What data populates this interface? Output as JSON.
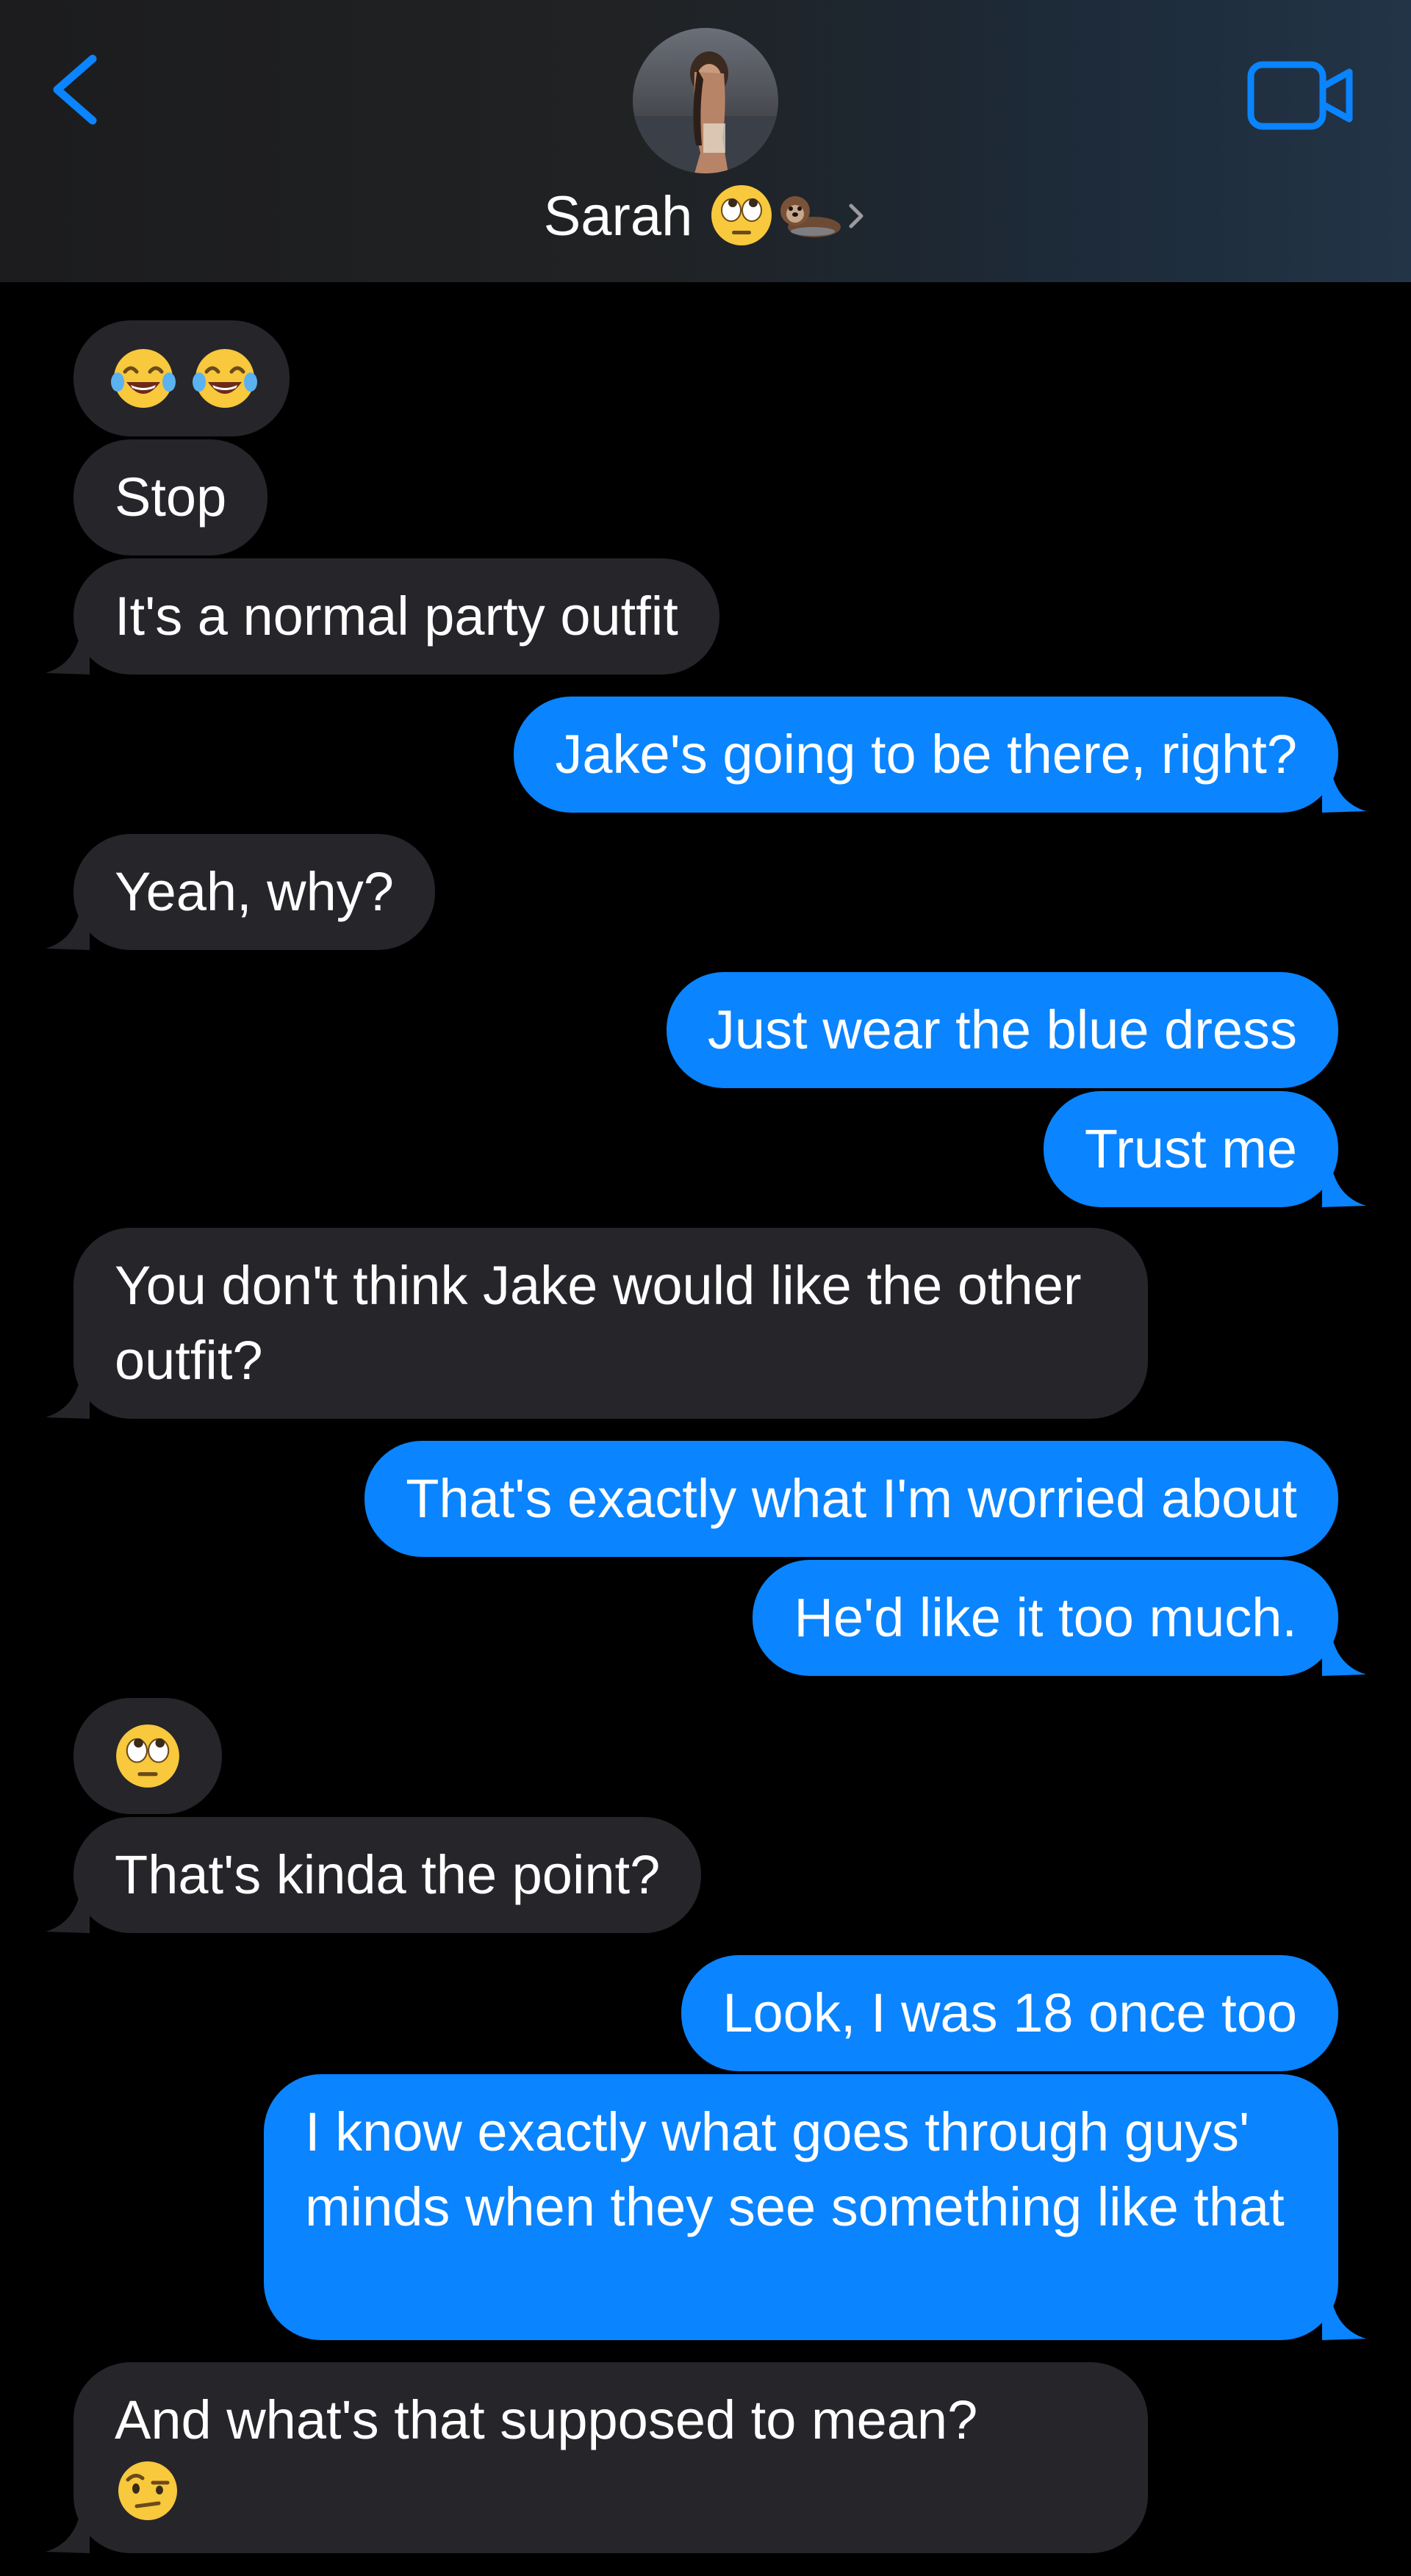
{
  "header": {
    "contact_name": "Sarah",
    "contact_emoji": [
      "eye-roll-emoji",
      "otter-emoji"
    ],
    "back_icon": "chevron-left-icon",
    "video_icon": "video-camera-icon",
    "accent_color": "#0a84ff"
  },
  "messages": [
    {
      "dir": "received",
      "text": "",
      "emoji": [
        "tears-of-joy-emoji",
        "tears-of-joy-emoji"
      ],
      "tail": false
    },
    {
      "dir": "received",
      "text": "Stop",
      "tail": false
    },
    {
      "dir": "received",
      "text": "It's a normal party outfit",
      "tail": true
    },
    {
      "dir": "sent",
      "text": "Jake's going to be there, right?",
      "tail": true
    },
    {
      "dir": "received",
      "text": "Yeah, why?",
      "tail": true
    },
    {
      "dir": "sent",
      "text": "Just wear the blue dress",
      "tail": false
    },
    {
      "dir": "sent",
      "text": "Trust me",
      "tail": true
    },
    {
      "dir": "received",
      "text": "You don't think Jake would like the other outfit?",
      "tail": true
    },
    {
      "dir": "sent",
      "text": "That's exactly what I'm worried about",
      "tail": false
    },
    {
      "dir": "sent",
      "text": "He'd like it too much.",
      "tail": true
    },
    {
      "dir": "received",
      "text": "",
      "emoji": [
        "eye-roll-emoji"
      ],
      "tail": false
    },
    {
      "dir": "received",
      "text": "That's kinda the point?",
      "tail": true
    },
    {
      "dir": "sent",
      "text": "Look, I was 18 once too",
      "tail": false
    },
    {
      "dir": "sent",
      "text": "I know exactly what goes through guys' minds when they see something like that",
      "tail": true
    },
    {
      "dir": "received",
      "text": "And what's that supposed to mean?",
      "emoji": [
        "raised-eyebrow-emoji"
      ],
      "tail": true
    }
  ],
  "colors": {
    "sent_bubble": "#0a84ff",
    "received_bubble": "#26252a",
    "background": "#000000"
  }
}
